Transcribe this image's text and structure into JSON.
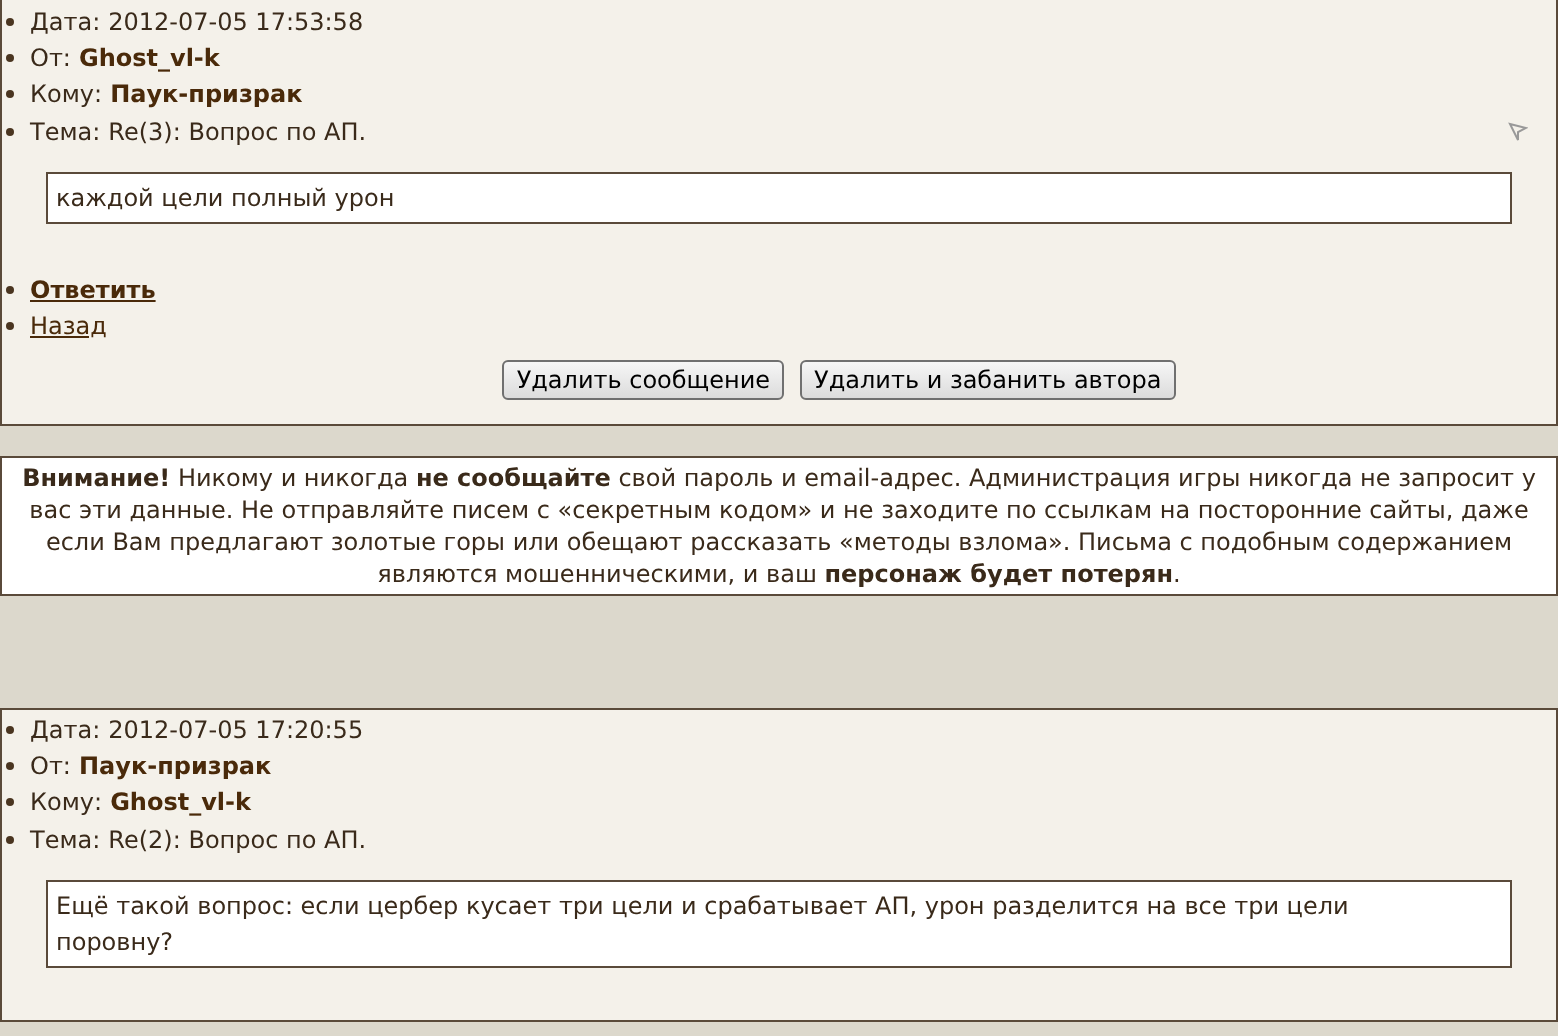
{
  "messages": [
    {
      "date_label": "Дата:",
      "date": "2012-07-05 17:53:58",
      "from_label": "От:",
      "from": "Ghost_vl-k",
      "to_label": "Кому:",
      "to": "Паук-призрак",
      "subject_label": "Тема:",
      "subject": "Re(3): Вопрос по АП.",
      "flag": true,
      "body": "каждой цели полный урон",
      "links": [
        {
          "label": "Ответить",
          "bold": true
        },
        {
          "label": "Назад",
          "bold": false
        }
      ],
      "buttons": [
        "Удалить сообщение",
        "Удалить и забанить автора"
      ]
    },
    {
      "date_label": "Дата:",
      "date": "2012-07-05 17:20:55",
      "from_label": "От:",
      "from": "Паук-призрак",
      "to_label": "Кому:",
      "to": "Ghost_vl-k",
      "subject_label": "Тема:",
      "subject": "Re(2): Вопрос по АП.",
      "flag": false,
      "body": "Ещё такой вопрос: если цербер кусает три цели и срабатывает АП, урон разделится на все три цели поровну?"
    }
  ],
  "warning": "**Внимание!** Никому и никогда **не сообщайте** свой пароль и email-адрес. Администрация игры никогда не запросит у вас эти данные. Не отправляйте писем с «секретным кодом» и не заходите по ссылкам на посторонние сайты, даже если Вам предлагают золотые горы или обещают рассказать «методы взлома». Письма с подобным содержанием являются мошенническими, и ваш **персонаж будет потерян**."
}
